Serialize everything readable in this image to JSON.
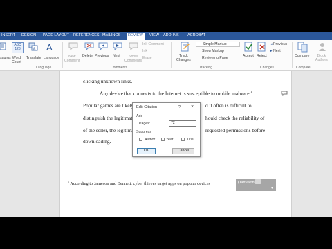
{
  "ribbon_tabs": [
    "INSERT",
    "DESIGN",
    "PAGE LAYOUT",
    "REFERENCES",
    "MAILINGS",
    "REVIEW",
    "VIEW",
    "ADD-INS",
    "ACROBAT"
  ],
  "active_tab": "REVIEW",
  "ribbon": {
    "proofing": {
      "thesaurus": "saurus",
      "abc": "ABC",
      "abc_num": "123",
      "word_count_1": "Word",
      "word_count_2": "Count"
    },
    "language": {
      "translate": "Translate",
      "language": "Language",
      "group": "Language"
    },
    "comments": {
      "new_1": "New",
      "new_2": "Comment",
      "delete": "Delete",
      "previous": "Previous",
      "next": "Next",
      "show_1": "Show",
      "show_2": "Comments",
      "group": "Comments"
    },
    "small_buttons": {
      "ink_comment": "Ink Comment",
      "ink": "Ink",
      "erase": "Erase"
    },
    "tracking": {
      "track_1": "Track",
      "track_2": "Changes",
      "simple_markup": "Simple Markup",
      "show_markup": "Show Markup",
      "reviewing_pane": "Reviewing Pane",
      "group": "Tracking"
    },
    "changes": {
      "accept": "Accept",
      "reject": "Reject",
      "previous": "Previous",
      "next": "Next",
      "group": "Changes"
    },
    "compare": {
      "compare": "Compare",
      "group": "Compare"
    },
    "protect": {
      "block_1": "Block",
      "block_2": "Authors"
    }
  },
  "document": {
    "lines": [
      "clicking unknown links.",
      "Any device that connects to the Internet is susceptible to mobile malware.",
      "Popular games are likely",
      "distinguish the legitimate",
      "of the seller, the legitimate",
      "downloading."
    ],
    "superscript_1": "1",
    "line3_right": "d it often is difficult to",
    "line4_right": "hould check the reliability of",
    "line5_right": "requested permissions before",
    "footnote_num": "1",
    "footnote_text": "According to Jameson and Bennett, cyber thieves target apps on popular devices",
    "footnote_citation": "(Jameson"
  },
  "dialog": {
    "title": "Edit Citation",
    "help": "?",
    "close": "×",
    "add_label": "Add",
    "pages_label": "Pages:",
    "pages_value": "72",
    "suppress_label": "Suppress",
    "author": "Author",
    "year": "Year",
    "title_cb": "Title",
    "ok": "OK",
    "cancel": "Cancel"
  }
}
